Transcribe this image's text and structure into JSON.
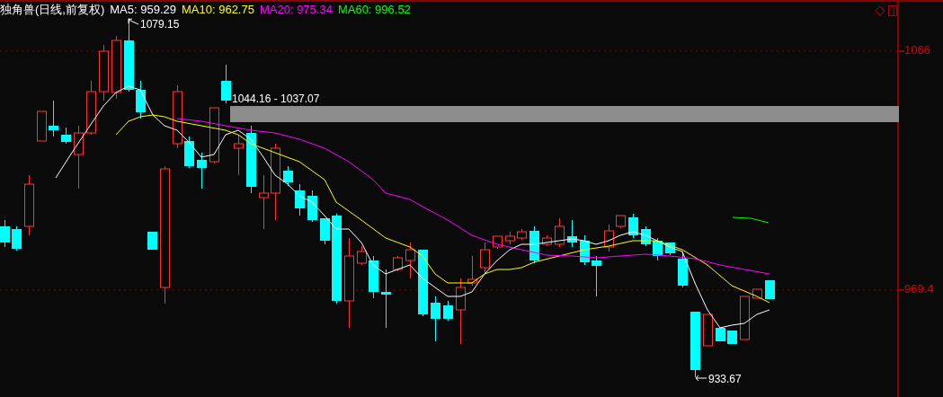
{
  "legend": {
    "title": "独角兽(日线,前复权)",
    "averages": [
      {
        "label": "MA5:",
        "value": "959.29",
        "color": "#ffffff"
      },
      {
        "label": "MA10:",
        "value": "962.75",
        "color": "#ffff00"
      },
      {
        "label": "MA20:",
        "value": "975.34",
        "color": "#ff00ff"
      },
      {
        "label": "MA60:",
        "value": "996.52",
        "color": "#00ff00"
      }
    ]
  },
  "price_axis": {
    "labels": [
      "1066",
      "969.4"
    ]
  },
  "annotations": {
    "high": "1079.15",
    "low": "933.67",
    "zone": "1044.16 - 1037.07"
  }
}
